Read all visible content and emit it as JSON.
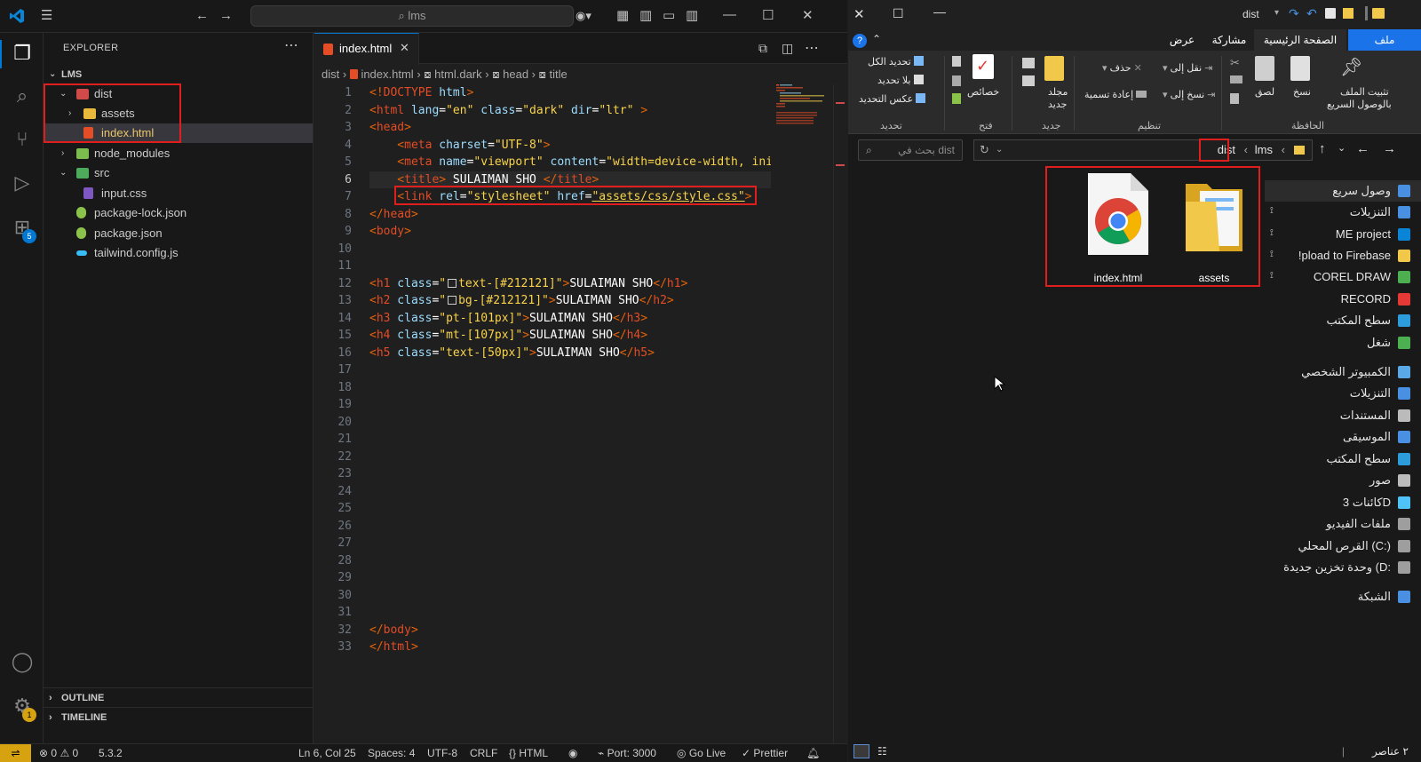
{
  "vscode": {
    "search_placeholder": "lms",
    "explorer_title": "EXPLORER",
    "root_folder": "LMS",
    "tree": [
      {
        "label": "dist"
      },
      {
        "label": "assets"
      },
      {
        "label": "index.html"
      },
      {
        "label": "node_modules"
      },
      {
        "label": "src"
      },
      {
        "label": "input.css"
      },
      {
        "label": "package-lock.json"
      },
      {
        "label": "package.json"
      },
      {
        "label": "tailwind.config.js"
      }
    ],
    "outline_label": "OUTLINE",
    "timeline_label": "TIMELINE",
    "active_tab": "index.html",
    "breadcrumb": [
      "dist",
      "index.html",
      "html.dark",
      "head",
      "title"
    ],
    "extensions_badge": "5",
    "settings_badge": "1",
    "line_numbers": [
      "1",
      "2",
      "3",
      "4",
      "5",
      "6",
      "7",
      "8",
      "9",
      "10",
      "11",
      "12",
      "13",
      "14",
      "15",
      "16",
      "17",
      "18",
      "19",
      "20",
      "21",
      "22",
      "23",
      "24",
      "25",
      "26",
      "27",
      "28",
      "29",
      "30",
      "31",
      "32",
      "33"
    ],
    "code": {
      "l1": [
        "<!",
        "DOCTYPE",
        " html",
        ">"
      ],
      "l2": [
        "<",
        "html",
        " lang",
        "=",
        "\"en\"",
        " class",
        "=",
        "\"dark\"",
        " dir",
        "=",
        "\"ltr\"",
        " >"
      ],
      "l3": [
        "<",
        "head",
        ">"
      ],
      "l4": [
        "    <",
        "meta",
        " charset",
        "=",
        "\"UTF-8\"",
        ">"
      ],
      "l5": [
        "    <",
        "meta",
        " name",
        "=",
        "\"viewport\"",
        " content",
        "=",
        "\"width=device-width, ini"
      ],
      "l6": [
        "    <",
        "title",
        ">",
        " SULAIMAN SHO ",
        "</",
        "title",
        ">"
      ],
      "l7": [
        "    <",
        "link",
        " rel",
        "=",
        "\"stylesheet\"",
        " href",
        "=",
        "\"assets/css/style.css\"",
        ">"
      ],
      "l8": [
        "</",
        "head",
        ">"
      ],
      "l9": [
        "<",
        "body",
        ">"
      ],
      "l12": [
        "<",
        "h1",
        " class",
        "=",
        "\"",
        "text-[#212121]\"",
        ">",
        "SULAIMAN SHO",
        "</",
        "h1",
        ">"
      ],
      "l13": [
        "<",
        "h2",
        " class",
        "=",
        "\"",
        "bg-[#212121]\"",
        ">",
        "SULAIMAN SHO",
        "</",
        "h2",
        ">"
      ],
      "l14": [
        "<",
        "h3",
        " class",
        "=",
        "\"pt-[101px]\"",
        ">",
        "SULAIMAN SHO",
        "</",
        "h3",
        ">"
      ],
      "l15": [
        "<",
        "h4",
        " class",
        "=",
        "\"mt-[107px]\"",
        ">",
        "SULAIMAN SHO",
        "</",
        "h4",
        ">"
      ],
      "l16": [
        "<",
        "h5",
        " class",
        "=",
        "\"text-[50px]\"",
        ">",
        "SULAIMAN SHO",
        "</",
        "h5",
        ">"
      ],
      "l32": [
        "</",
        "body",
        ">"
      ],
      "l33": [
        "</",
        "html",
        ">"
      ]
    },
    "status": {
      "errors": "0",
      "warnings": "0",
      "version": "5.3.2",
      "position": "Ln 6, Col 25",
      "spaces": "Spaces: 4",
      "encoding": "UTF-8",
      "eol": "CRLF",
      "language": "HTML",
      "port": "Port: 3000",
      "golive": "Go Live",
      "prettier": "Prettier"
    }
  },
  "explorer": {
    "title": "dist",
    "tabs": {
      "file": "ملف",
      "home": "الصفحة الرئيسية",
      "share": "مشاركة",
      "view": "عرض"
    },
    "ribbon": {
      "pin": "تثبيت الملف",
      "pin2": "بالوصول السريع",
      "copy": "نسخ",
      "paste": "لصق",
      "clipboard": "الحافظة",
      "move_to": "نقل إلى",
      "copy_to": "نسخ إلى",
      "delete": "حذف",
      "rename": "إعادة تسمية",
      "organize": "تنظيم",
      "new_folder": "مجلد",
      "new_folder2": "جديد",
      "new": "جديد",
      "properties": "خصائص",
      "open": "فتح",
      "select_all": "تحديد الكل",
      "select_none": "بلا تحديد",
      "invert": "عكس التحديد",
      "select": "تحديد"
    },
    "address": [
      "dist",
      "lms"
    ],
    "search_placeholder": "بحث في dist",
    "nav": [
      {
        "label": "وصول سريع"
      },
      {
        "label": "التنزيلات"
      },
      {
        "label": "ME project"
      },
      {
        "label": "!pload to Firebase"
      },
      {
        "label": "COREL DRAW"
      },
      {
        "label": "RECORD"
      },
      {
        "label": "سطح المكتب"
      },
      {
        "label": "شغل"
      },
      {
        "label": "الكمبيوتر الشخصي"
      },
      {
        "label": "التنزيلات"
      },
      {
        "label": "المستندات"
      },
      {
        "label": "الموسيقى"
      },
      {
        "label": "سطح المكتب"
      },
      {
        "label": "صور"
      },
      {
        "label": "كائنات 3D"
      },
      {
        "label": "ملفات الفيديو"
      },
      {
        "label": "القرص المحلي (C:)"
      },
      {
        "label": "وحدة تخزين جديدة (D:"
      },
      {
        "label": "الشبكة"
      }
    ],
    "files": [
      {
        "name": "index.html",
        "icon": "chrome-icon"
      },
      {
        "name": "assets",
        "icon": "folder-icon"
      }
    ],
    "status_count": "٢ عناصر"
  },
  "colors": {
    "accent": "#0078d4",
    "highlight_red": "#e01e1e",
    "folder": "#f2c84b",
    "status_gold": "#d7a20f"
  }
}
